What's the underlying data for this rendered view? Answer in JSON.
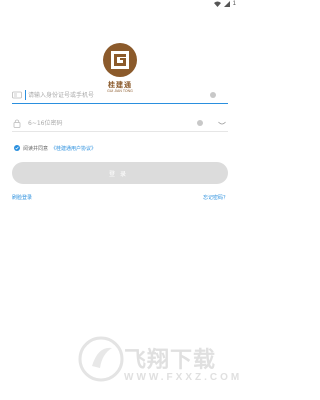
{
  "status_bar": {
    "signal_count": "1"
  },
  "brand": {
    "name": "桂建通",
    "subtitle": "GUI JIAN TONG"
  },
  "login_form": {
    "id_placeholder": "请输入身份证号或手机号",
    "password_placeholder": "6~16位密码",
    "agree_prefix": "阅读并同意",
    "agree_link": "《桂建通用户协议》",
    "login_label": "登录",
    "face_login_label": "刷脸登录",
    "forgot_label": "忘记密码？"
  },
  "watermark": {
    "title": "飞翔下载",
    "url": "WWW.FXXZ.COM"
  },
  "colors": {
    "accent": "#2a8fde",
    "brand": "#8b5a2b",
    "disabled_button": "#dcdcdc"
  }
}
